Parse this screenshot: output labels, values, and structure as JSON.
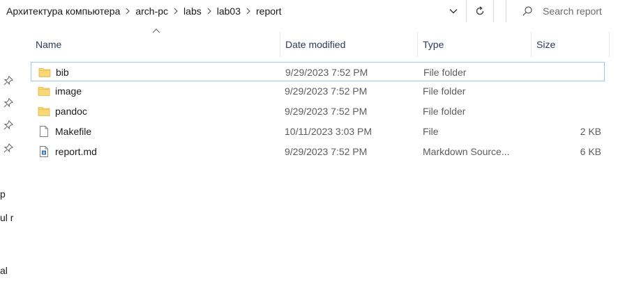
{
  "address_bar": {
    "crumbs": [
      "Архитектура компьютера",
      "arch-pc",
      "labs",
      "lab03",
      "report"
    ]
  },
  "search": {
    "placeholder": "Search report"
  },
  "nav_pane": {
    "fragments": [
      "p",
      "ul r",
      "al"
    ]
  },
  "columns": {
    "name": "Name",
    "date": "Date modified",
    "type": "Type",
    "size": "Size"
  },
  "files": [
    {
      "name": "bib",
      "date": "9/29/2023 7:52 PM",
      "type": "File folder",
      "size": "",
      "icon": "folder-icon"
    },
    {
      "name": "image",
      "date": "9/29/2023 7:52 PM",
      "type": "File folder",
      "size": "",
      "icon": "folder-icon"
    },
    {
      "name": "pandoc",
      "date": "9/29/2023 7:52 PM",
      "type": "File folder",
      "size": "",
      "icon": "folder-icon"
    },
    {
      "name": "Makefile",
      "date": "10/11/2023 3:03 PM",
      "type": "File",
      "size": "2 KB",
      "icon": "file-icon"
    },
    {
      "name": "report.md",
      "date": "9/29/2023 7:52 PM",
      "type": "Markdown Source...",
      "size": "6 KB",
      "icon": "markdown-file-icon"
    }
  ],
  "colors": {
    "selection_border": "#99c9ef",
    "folder": "#f8d775",
    "header_text": "#2b3b5a"
  }
}
